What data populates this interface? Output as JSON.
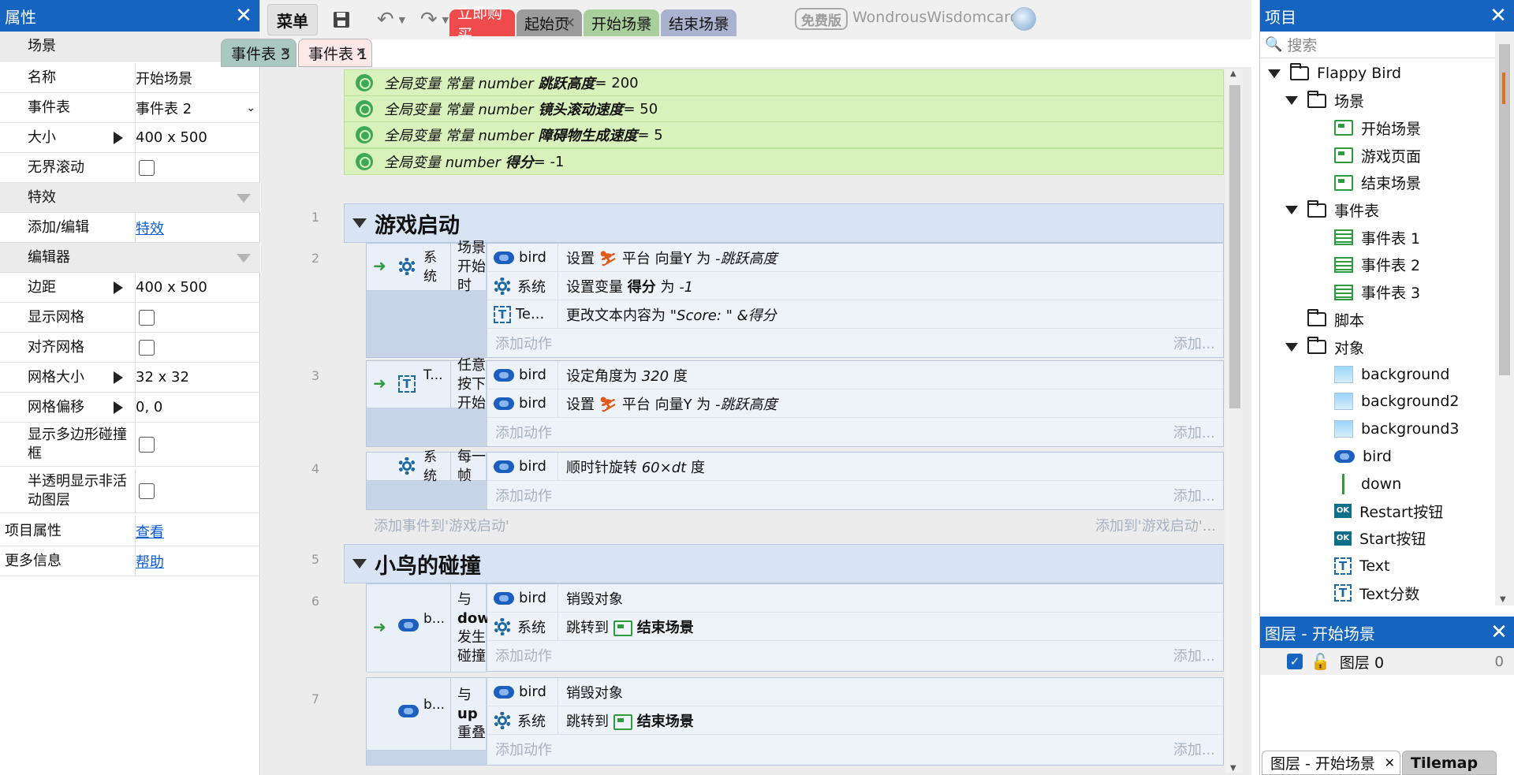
{
  "left_panel": {
    "title": "属性",
    "rows": [
      {
        "type": "section",
        "label": "场景"
      },
      {
        "type": "text",
        "label": "名称",
        "value": "开始场景"
      },
      {
        "type": "select",
        "label": "事件表",
        "value": "事件表 2"
      },
      {
        "type": "expand",
        "label": "大小",
        "value": "400 x 500"
      },
      {
        "type": "check",
        "label": "无界滚动"
      },
      {
        "type": "section",
        "label": "特效"
      },
      {
        "type": "link",
        "label": "添加/编辑",
        "value": "特效"
      },
      {
        "type": "section",
        "label": "编辑器"
      },
      {
        "type": "expand",
        "label": "边距",
        "value": "400 x 500"
      },
      {
        "type": "check",
        "label": "显示网格"
      },
      {
        "type": "check",
        "label": "对齐网格"
      },
      {
        "type": "expand",
        "label": "网格大小",
        "value": "32 x 32"
      },
      {
        "type": "expand",
        "label": "网格偏移",
        "value": "0, 0"
      },
      {
        "type": "check",
        "label": "显示多边形碰撞框"
      },
      {
        "type": "check",
        "label": "半透明显示非活动图层"
      },
      {
        "type": "link",
        "label": "项目属性",
        "value": "查看"
      },
      {
        "type": "link",
        "label": "更多信息",
        "value": "帮助"
      }
    ]
  },
  "toolbar": {
    "menu_label": "菜单",
    "tabs": [
      {
        "label": "立即购买",
        "bg": "#f04b4b",
        "color": "#ffffff"
      },
      {
        "label": "起始页",
        "bg": "#9b9b9b",
        "color": "#111111"
      },
      {
        "label": "开始场景",
        "bg": "#a8cf9c",
        "color": "#111111"
      },
      {
        "label": "结束场景",
        "bg": "#a9b3cf",
        "color": "#111111"
      }
    ],
    "free_badge": "免费版",
    "user_name": "WondrousWisdomcard"
  },
  "event_tabs": [
    {
      "label": "事件表 3",
      "active": false
    },
    {
      "label": "事件表 1",
      "active": true
    }
  ],
  "globals": [
    {
      "prefix": "全局变量 常量 number ",
      "name": "跳跃高度",
      "suffix": " = 200"
    },
    {
      "prefix": "全局变量 常量 number ",
      "name": "镜头滚动速度",
      "suffix": " = 50"
    },
    {
      "prefix": "全局变量 常量 number ",
      "name": "障碍物生成速度",
      "suffix": " = 5"
    },
    {
      "prefix": "全局变量 number ",
      "name": "得分",
      "suffix": " = -1"
    }
  ],
  "events": {
    "line_numbers": [
      "1",
      "2",
      "3",
      "4",
      "5",
      "6",
      "7"
    ],
    "group1_title": "游戏启动",
    "group2_title": "小鸟的碰撞",
    "e2": {
      "cond_obj": "系统",
      "cond_text": "场景开始时",
      "actions": [
        {
          "obj": "bird",
          "text": "设置 ",
          "mid": "平台 向量Y 为 ",
          "val": "-跳跃高度"
        },
        {
          "obj": "系统",
          "text": "设置变量 ",
          "bold": "得分",
          "mid": " 为 ",
          "val": "-1"
        },
        {
          "obj": "Te...",
          "text": "更改文本内容为 ",
          "val": "\"Score: \" &得分"
        }
      ]
    },
    "e3": {
      "cond_obj": "T...",
      "cond_text": "任意按下开始",
      "actions": [
        {
          "obj": "bird",
          "text": "设定角度为 ",
          "val": "320",
          "after": " 度"
        },
        {
          "obj": "bird",
          "text": "设置 ",
          "mid": "平台 向量Y 为 ",
          "val": "-跳跃高度"
        }
      ]
    },
    "e4": {
      "cond_obj": "系统",
      "cond_text": "每一帧",
      "actions": [
        {
          "obj": "bird",
          "text": "顺时针旋转 ",
          "val": "60×dt",
          "after": " 度"
        }
      ]
    },
    "add_action": "添加动作",
    "add_action_right": "添加...",
    "add_event_left": "添加事件到'游戏启动'",
    "add_event_right": "添加到'游戏启动'...",
    "e6": {
      "cond_obj": "b...",
      "cond_pre": "与",
      "cond_bold": "down",
      "cond_post": "发生碰撞",
      "actions": [
        {
          "obj": "bird",
          "text": "销毁对象"
        },
        {
          "obj": "系统",
          "text": "跳转到 ",
          "bold": "结束场景"
        }
      ]
    },
    "e7": {
      "cond_obj": "b...",
      "cond_pre": "与",
      "cond_bold": "up",
      "cond_post": "重叠",
      "actions": [
        {
          "obj": "bird",
          "text": "销毁对象"
        },
        {
          "obj": "系统",
          "text": "跳转到 ",
          "bold": "结束场景"
        }
      ]
    }
  },
  "right_panel": {
    "title": "项目",
    "search_placeholder": "搜索",
    "tree": [
      {
        "label": "Flappy Bird",
        "icon": "folder",
        "indent": 0,
        "expanded": true
      },
      {
        "label": "场景",
        "icon": "folder",
        "indent": 1,
        "expanded": true
      },
      {
        "label": "开始场景",
        "icon": "scene",
        "indent": 2
      },
      {
        "label": "游戏页面",
        "icon": "scene",
        "indent": 2
      },
      {
        "label": "结束场景",
        "icon": "scene",
        "indent": 2
      },
      {
        "label": "事件表",
        "icon": "folder",
        "indent": 1,
        "expanded": true
      },
      {
        "label": "事件表 1",
        "icon": "table",
        "indent": 2
      },
      {
        "label": "事件表 2",
        "icon": "table",
        "indent": 2
      },
      {
        "label": "事件表 3",
        "icon": "table",
        "indent": 2
      },
      {
        "label": "脚本",
        "icon": "folder",
        "indent": 1
      },
      {
        "label": "对象",
        "icon": "folder",
        "indent": 1,
        "expanded": true
      },
      {
        "label": "background",
        "icon": "image",
        "indent": 2
      },
      {
        "label": "background2",
        "icon": "image",
        "indent": 2
      },
      {
        "label": "background3",
        "icon": "image",
        "indent": 2
      },
      {
        "label": "bird",
        "icon": "bird",
        "indent": 2
      },
      {
        "label": "down",
        "icon": "line",
        "indent": 2
      },
      {
        "label": "Restart按钮",
        "icon": "button",
        "indent": 2
      },
      {
        "label": "Start按钮",
        "icon": "button",
        "indent": 2
      },
      {
        "label": "Text",
        "icon": "text",
        "indent": 2
      },
      {
        "label": "Text分数",
        "icon": "text",
        "indent": 2
      }
    ],
    "layers_title": "图层 - 开始场景",
    "layer_name": "图层 0",
    "layer_index": "0",
    "bottom_tabs": [
      "图层 - 开始场景",
      "Tilemap"
    ]
  }
}
